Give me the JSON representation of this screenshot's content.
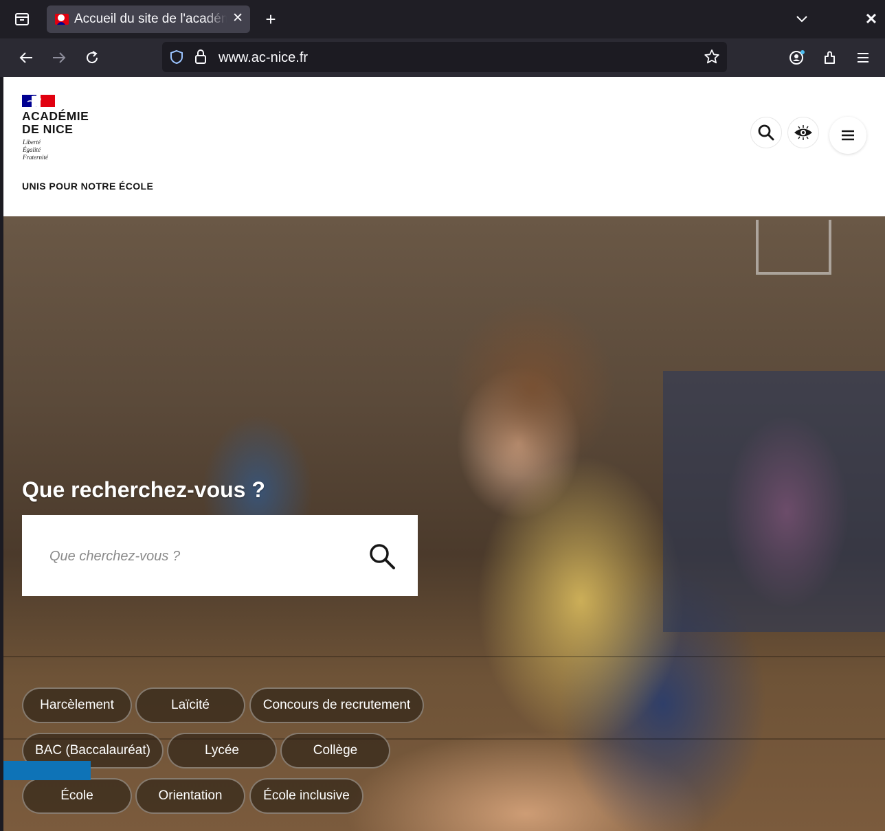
{
  "browser": {
    "tab_title": "Accueil du site de l'académie",
    "url_host": "www.ac-nice.fr",
    "icons": [
      "tab-list-icon",
      "favicon-marianne-icon",
      "close-icon",
      "plus-icon",
      "chevron-down-icon",
      "close-window-icon",
      "back-arrow-icon",
      "forward-arrow-icon",
      "reload-icon",
      "shield-icon",
      "lock-icon",
      "star-icon",
      "account-icon",
      "extensions-icon",
      "menu-icon"
    ]
  },
  "header": {
    "logo_line1": "ACADÉMIE",
    "logo_line2": "DE NICE",
    "motto_1": "Liberté",
    "motto_2": "Égalité",
    "motto_3": "Fraternité",
    "tagline": "UNIS POUR NOTRE ÉCOLE",
    "buttons": [
      "search-icon",
      "eye-icon",
      "menu-icon"
    ]
  },
  "hero": {
    "title": "Que recherchez-vous ?",
    "search_placeholder": "Que cherchez-vous ?",
    "tags": [
      "Harcèlement",
      "Laïcité",
      "Concours de recrutement",
      "BAC (Baccalauréat)",
      "Lycée",
      "Collège",
      "École",
      "Orientation",
      "École inclusive"
    ]
  },
  "colors": {
    "chrome_dark": "#1f1e25",
    "tab_active": "#42414d",
    "accent_blue": "#0e73b7",
    "marianne_blue": "#000091",
    "marianne_red": "#e1000f"
  }
}
